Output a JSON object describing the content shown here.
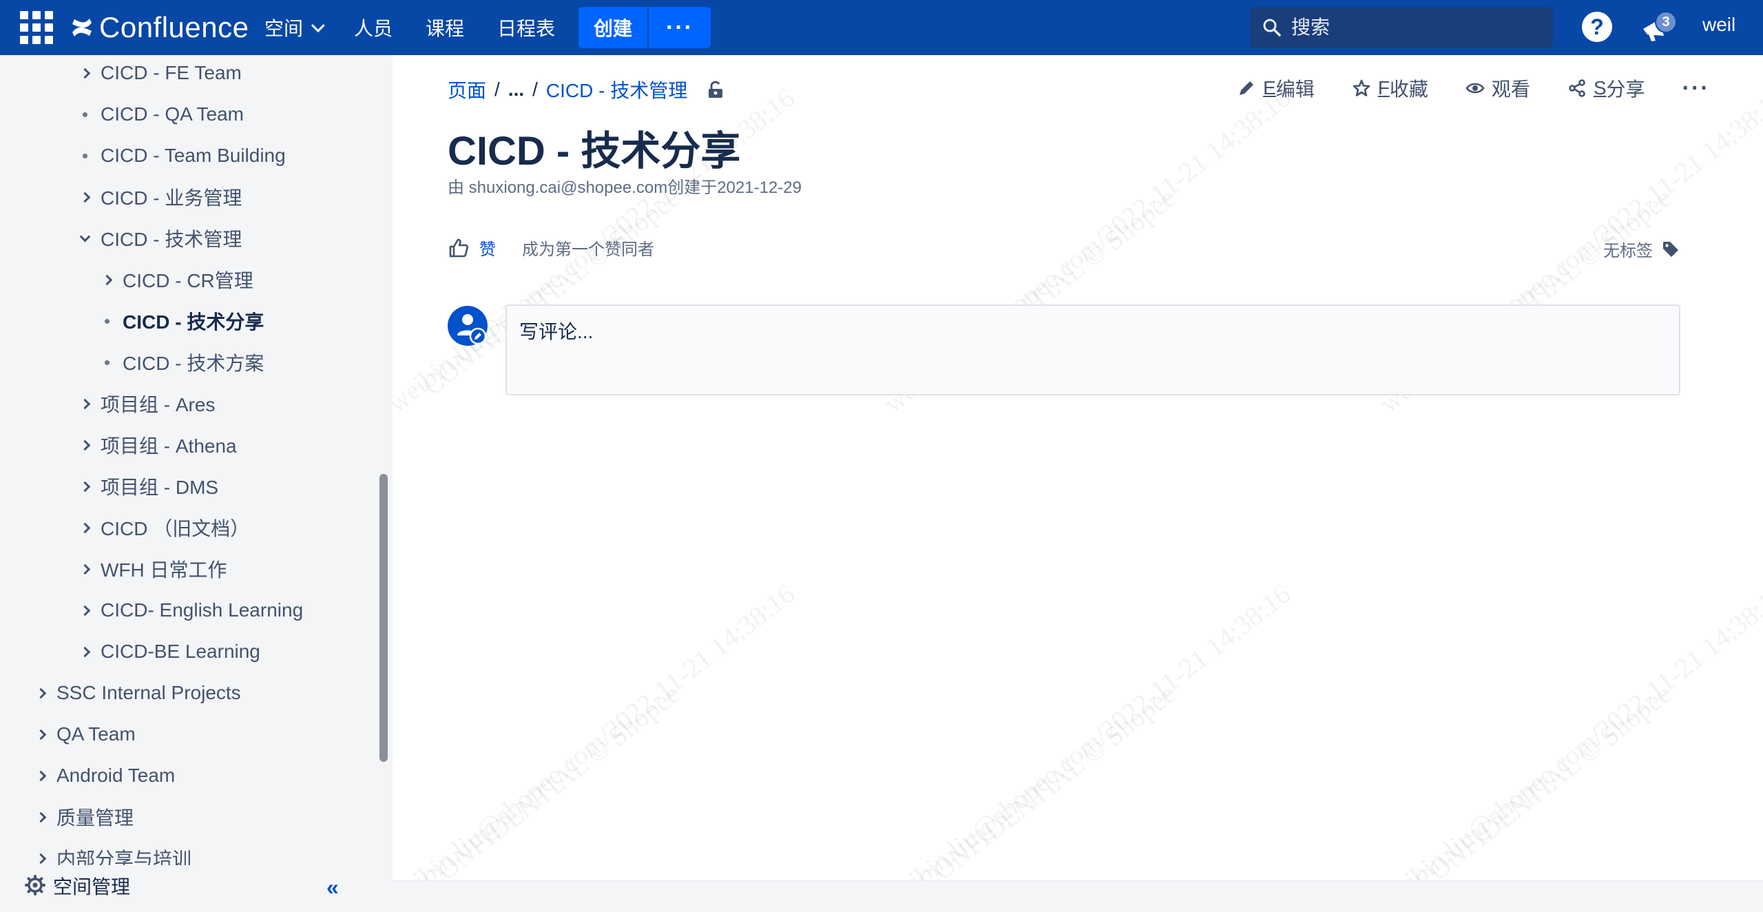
{
  "topnav": {
    "app_name": "Confluence",
    "items": [
      {
        "label": "空间",
        "has_dropdown": true
      },
      {
        "label": "人员"
      },
      {
        "label": "课程"
      },
      {
        "label": "日程表"
      }
    ],
    "create_label": "创建",
    "more_label": "···",
    "search_placeholder": "搜索",
    "help_label": "?",
    "notification_count": "3",
    "user_label": "weil",
    "brand_color": "#0747a6",
    "accent_color": "#0065ff"
  },
  "sidebar": {
    "tree": [
      {
        "label": "CICD - FE Team",
        "marker": "chevron-right",
        "level": 1
      },
      {
        "label": "CICD - QA Team",
        "marker": "dot",
        "level": 1
      },
      {
        "label": "CICD - Team Building",
        "marker": "dot",
        "level": 1
      },
      {
        "label": "CICD - 业务管理",
        "marker": "chevron-right",
        "level": 1
      },
      {
        "label": "CICD - 技术管理",
        "marker": "chevron-down",
        "level": 1
      },
      {
        "label": "CICD - CR管理",
        "marker": "chevron-right",
        "level": 2
      },
      {
        "label": "CICD - 技术分享",
        "marker": "dot",
        "level": 2,
        "active": true
      },
      {
        "label": "CICD - 技术方案",
        "marker": "dot",
        "level": 2
      },
      {
        "label": "项目组 - Ares",
        "marker": "chevron-right",
        "level": 1
      },
      {
        "label": "项目组 - Athena",
        "marker": "chevron-right",
        "level": 1
      },
      {
        "label": "项目组 - DMS",
        "marker": "chevron-right",
        "level": 1
      },
      {
        "label": "CICD （旧文档）",
        "marker": "chevron-right",
        "level": 1
      },
      {
        "label": "WFH 日常工作",
        "marker": "chevron-right",
        "level": 1
      },
      {
        "label": "CICD- English Learning",
        "marker": "chevron-right",
        "level": 1
      },
      {
        "label": "CICD-BE Learning",
        "marker": "chevron-right",
        "level": 1
      },
      {
        "label": "SSC Internal Projects",
        "marker": "chevron-right",
        "level": 0
      },
      {
        "label": "QA Team",
        "marker": "chevron-right",
        "level": 0
      },
      {
        "label": "Android Team",
        "marker": "chevron-right",
        "level": 0
      },
      {
        "label": "质量管理",
        "marker": "chevron-right",
        "level": 0
      },
      {
        "label": "内部分享与培训",
        "marker": "chevron-right",
        "level": 0
      }
    ],
    "footer": {
      "space_settings_label": "空间管理",
      "collapse_label": "«"
    }
  },
  "page": {
    "breadcrumb": {
      "root": "页面",
      "ellipsis": "...",
      "parent": "CICD - 技术管理",
      "separator": "/"
    },
    "actions": [
      {
        "key": "E",
        "label": "编辑",
        "icon": "pencil-icon"
      },
      {
        "key": "F",
        "label": "收藏",
        "icon": "star-icon"
      },
      {
        "key": "",
        "label": "观看",
        "icon": "eye-icon"
      },
      {
        "key": "S",
        "label": "分享",
        "icon": "share-icon"
      }
    ],
    "more_actions_label": "···",
    "title": "CICD - 技术分享",
    "byline": "由 shuxiong.cai@shopee.com创建于2021-12-29",
    "like_label": "赞",
    "like_hint": "成为第一个赞同者",
    "labels_text": "无标签",
    "comment_placeholder": "写评论..."
  },
  "watermark": {
    "line1": "weibin.liu@shopee.com/2022-11-21 14:38:16",
    "line2": "CONFIDENTIAL © Shopee"
  }
}
